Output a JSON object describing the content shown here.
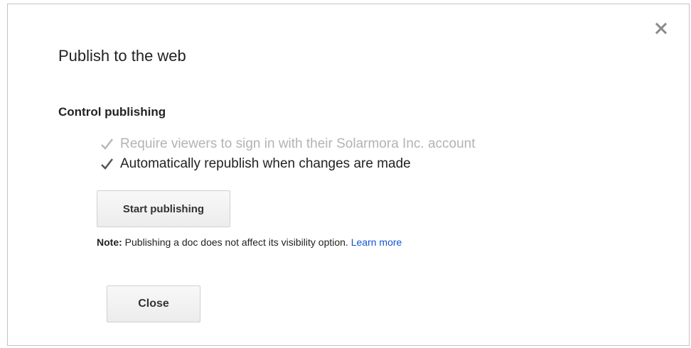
{
  "dialog": {
    "title": "Publish to the web",
    "close_icon": "close-icon",
    "section_heading": "Control publishing",
    "options": [
      {
        "label": "Require viewers to sign in with their Solarmora Inc. account",
        "checked": true,
        "disabled": true
      },
      {
        "label": "Automatically republish when changes are made",
        "checked": true,
        "disabled": false
      }
    ],
    "start_publishing_label": "Start publishing",
    "note": {
      "label": "Note:",
      "text": " Publishing a doc does not affect its visibility option. ",
      "link": "Learn more"
    },
    "close_label": "Close"
  },
  "colors": {
    "link": "#1155cc",
    "disabled_text": "#b3b3b3",
    "text": "#222222",
    "border": "#c4c4c4"
  }
}
